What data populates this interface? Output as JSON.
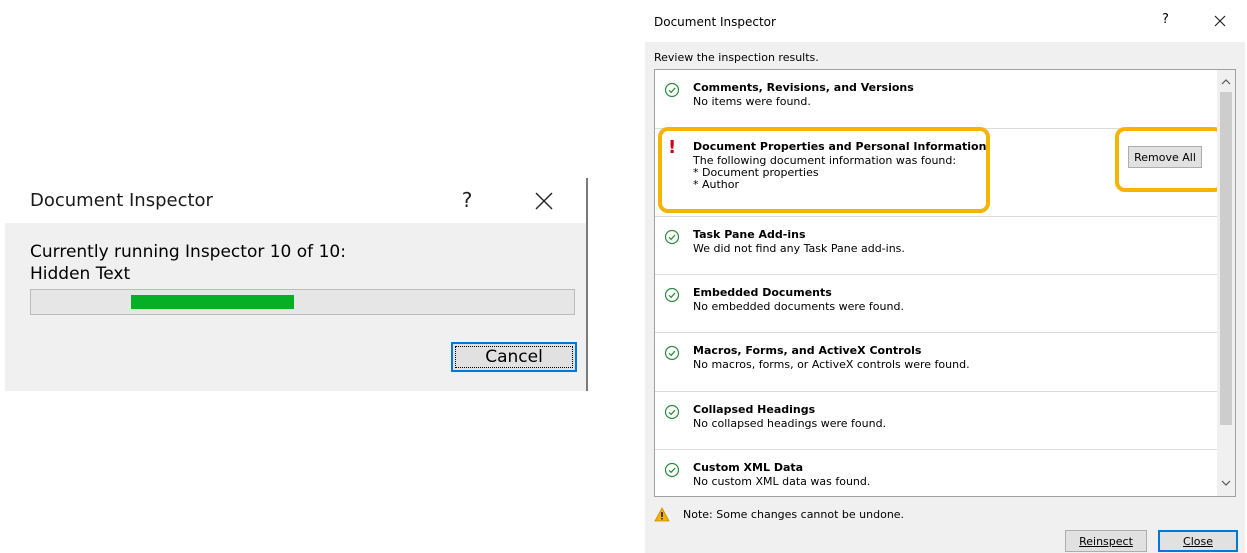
{
  "progress_dialog": {
    "title": "Document Inspector",
    "help": "?",
    "status_line1": "Currently running Inspector 10 of 10:",
    "status_line2": "Hidden Text",
    "progress_fraction": 0.3,
    "progress_color": "#06b025",
    "cancel_label": "Cancel",
    "accent": "#0078d7"
  },
  "results_dialog": {
    "title": "Document Inspector",
    "help": "?",
    "subtitle": "Review the inspection results.",
    "items": [
      {
        "name": "Comments, Revisions, and Versions",
        "desc": [
          "No items were found."
        ],
        "status": "ok-icon"
      },
      {
        "name": "Document Properties and Personal Information",
        "desc": [
          "The following document information was found:",
          "* Document properties",
          "* Author"
        ],
        "status": "warning-exclamation-icon",
        "action": "Remove All"
      },
      {
        "name": "Task Pane Add-ins",
        "desc": [
          "We did not find any Task Pane add-ins."
        ],
        "status": "ok-icon"
      },
      {
        "name": "Embedded Documents",
        "desc": [
          "No embedded documents were found."
        ],
        "status": "ok-icon"
      },
      {
        "name": "Macros, Forms, and ActiveX Controls",
        "desc": [
          "No macros, forms, or ActiveX controls were found."
        ],
        "status": "ok-icon"
      },
      {
        "name": "Collapsed Headings",
        "desc": [
          "No collapsed headings were found."
        ],
        "status": "ok-icon"
      },
      {
        "name": "Custom XML Data",
        "desc": [
          "No custom XML data was found."
        ],
        "status": "ok-icon"
      }
    ],
    "note": "Note: Some changes cannot be undone.",
    "reinspect_label": "Reinspect",
    "close_label": "Close",
    "highlight_color": "#f5b400",
    "ok_color": "#2e8b3e",
    "alert_color": "#d0021b"
  }
}
